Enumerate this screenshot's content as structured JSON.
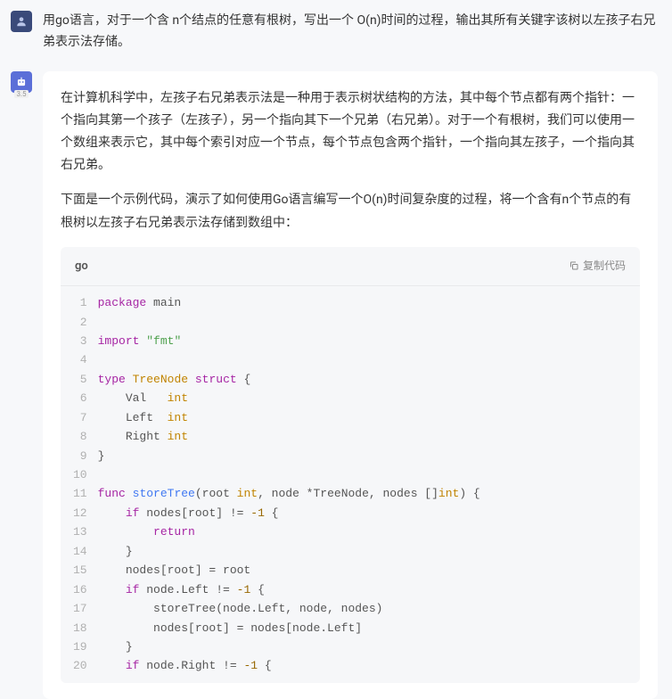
{
  "user": {
    "text": "用go语言，对于一个含 n个结点的任意有根树，写出一个 O(n)时间的过程，输出其所有关键字该树以左孩子右兄弟表示法存储。"
  },
  "assistant": {
    "badge": "3.5",
    "paragraphs": [
      "在计算机科学中，左孩子右兄弟表示法是一种用于表示树状结构的方法，其中每个节点都有两个指针：一个指向其第一个孩子（左孩子），另一个指向其下一个兄弟（右兄弟）。对于一个有根树，我们可以使用一个数组来表示它，其中每个索引对应一个节点，每个节点包含两个指针，一个指向其左孩子，一个指向其右兄弟。",
      "下面是一个示例代码，演示了如何使用Go语言编写一个O(n)时间复杂度的过程，将一个含有n个节点的有根树以左孩子右兄弟表示法存储到数组中："
    ]
  },
  "code": {
    "lang": "go",
    "copy_label": "复制代码",
    "lines": [
      {
        "n": 1,
        "html": "<span class='kw'>package</span> main"
      },
      {
        "n": 2,
        "html": ""
      },
      {
        "n": 3,
        "html": "<span class='kw'>import</span> <span class='str'>\"fmt\"</span>"
      },
      {
        "n": 4,
        "html": ""
      },
      {
        "n": 5,
        "html": "<span class='kw'>type</span> <span class='type'>TreeNode</span> <span class='kw'>struct</span> {"
      },
      {
        "n": 6,
        "html": "    Val   <span class='type'>int</span>"
      },
      {
        "n": 7,
        "html": "    Left  <span class='type'>int</span>"
      },
      {
        "n": 8,
        "html": "    Right <span class='type'>int</span>"
      },
      {
        "n": 9,
        "html": "}"
      },
      {
        "n": 10,
        "html": ""
      },
      {
        "n": 11,
        "html": "<span class='kw'>func</span> <span class='fn'>storeTree</span>(root <span class='type'>int</span>, node *TreeNode, nodes []<span class='type'>int</span>) {"
      },
      {
        "n": 12,
        "html": "    <span class='kw'>if</span> nodes[root] != <span class='num'>-1</span> {"
      },
      {
        "n": 13,
        "html": "        <span class='kw'>return</span>"
      },
      {
        "n": 14,
        "html": "    }"
      },
      {
        "n": 15,
        "html": "    nodes[root] = root"
      },
      {
        "n": 16,
        "html": "    <span class='kw'>if</span> node.Left != <span class='num'>-1</span> {"
      },
      {
        "n": 17,
        "html": "        storeTree(node.Left, node, nodes)"
      },
      {
        "n": 18,
        "html": "        nodes[root] = nodes[node.Left]"
      },
      {
        "n": 19,
        "html": "    }"
      },
      {
        "n": 20,
        "html": "    <span class='kw'>if</span> node.Right != <span class='num'>-1</span> {"
      }
    ]
  }
}
